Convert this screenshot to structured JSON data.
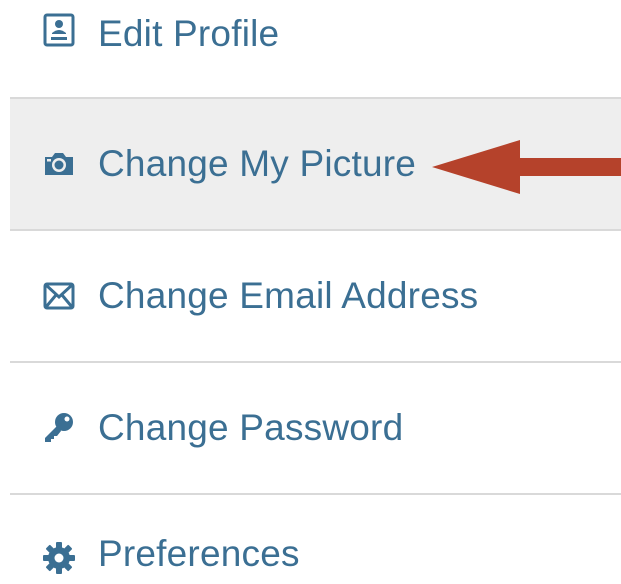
{
  "menu": {
    "items": [
      {
        "label": "Edit Profile",
        "icon": "profile-card-icon",
        "active": false
      },
      {
        "label": "Change My Picture",
        "icon": "camera-icon",
        "active": true
      },
      {
        "label": "Change Email Address",
        "icon": "envelope-icon",
        "active": false
      },
      {
        "label": "Change Password",
        "icon": "key-icon",
        "active": false
      },
      {
        "label": "Preferences",
        "icon": "gear-icon",
        "active": false
      }
    ]
  },
  "colors": {
    "label": "#3b6f93",
    "icon": "#3b6f93",
    "active_background": "#eeeeee",
    "divider": "#d9d9d9",
    "arrow": "#b5422b"
  }
}
